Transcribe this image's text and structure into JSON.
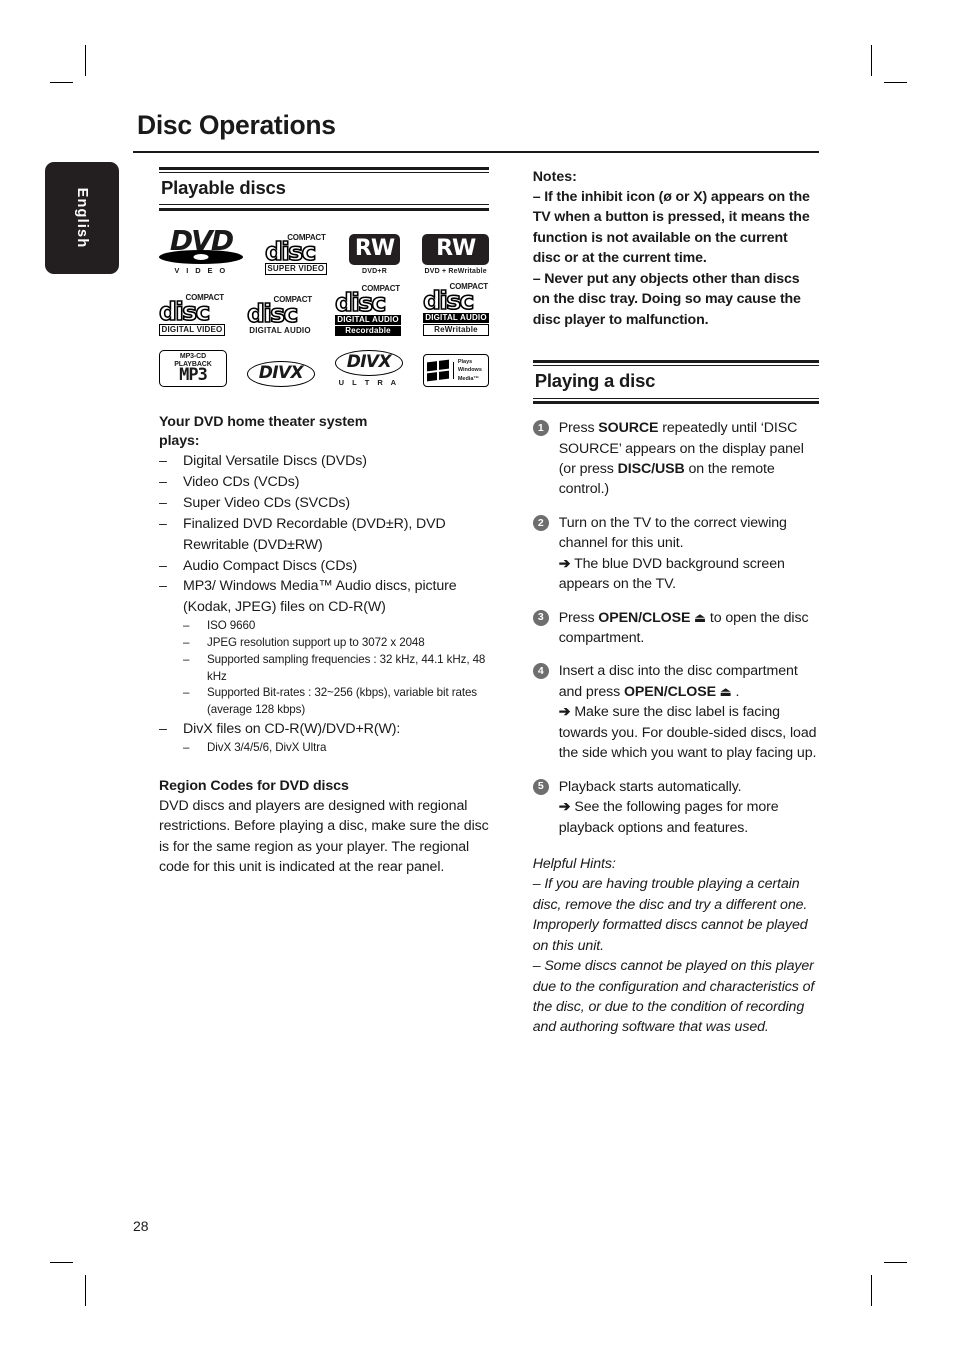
{
  "page": {
    "title": "Disc Operations",
    "number": "28",
    "language_tab": "English"
  },
  "left_column": {
    "section": {
      "title": "Playable discs"
    },
    "disc_logos": [
      [
        {
          "name": "dvd-video-logo",
          "mark": "DVD",
          "sub": "V I D E O"
        },
        {
          "name": "super-video-cd-logo",
          "top": "COMPACT",
          "word": "disc",
          "bar": "SUPER  VIDEO",
          "style": "boxed"
        },
        {
          "name": "dvd-plus-r-logo",
          "word": "RW",
          "sub": "DVD+R"
        },
        {
          "name": "dvd-plus-rewritable-logo",
          "word": "RW",
          "sub": "DVD + ReWritable"
        }
      ],
      [
        {
          "name": "compact-disc-digital-video-logo",
          "top": "COMPACT",
          "word": "disc",
          "bar": "DIGITAL VIDEO",
          "style": "boxed"
        },
        {
          "name": "compact-disc-digital-audio-logo",
          "top": "COMPACT",
          "word": "disc",
          "bar": "DIGITAL AUDIO",
          "style": "plain"
        },
        {
          "name": "compact-disc-recordable-logo",
          "top": "COMPACT",
          "word": "disc",
          "bar": "DIGITAL AUDIO",
          "bar2": "Recordable",
          "style": "inv"
        },
        {
          "name": "compact-disc-rewritable-logo",
          "top": "COMPACT",
          "word": "disc",
          "bar": "DIGITAL AUDIO",
          "bar2": "ReWritable",
          "style": "boxed2"
        }
      ],
      [
        {
          "name": "mp3-cd-playback-logo",
          "top": "MP3-CD PLAYBACK",
          "dots": "MP3"
        },
        {
          "name": "divx-logo",
          "word": "DIVX"
        },
        {
          "name": "divx-ultra-logo",
          "word": "DIVX",
          "sub": "U L T R A"
        },
        {
          "name": "windows-media-logo",
          "line1": "Plays",
          "line2": "Windows",
          "line3": "Media™"
        }
      ]
    ],
    "plays_heading_line1": "Your DVD home theater system",
    "plays_heading_line2": "plays:",
    "plays_items": [
      {
        "text": "Digital Versatile Discs (DVDs)"
      },
      {
        "text": "Video CDs (VCDs)"
      },
      {
        "text": "Super Video CDs (SVCDs)"
      },
      {
        "text": "Finalized DVD Recordable (DVD±R), DVD Rewritable (DVD±RW)"
      },
      {
        "text": "Audio Compact Discs (CDs)"
      },
      {
        "text": "MP3/ Windows Media™ Audio discs, picture (Kodak, JPEG) files on CD-R(W)",
        "sub_items": [
          "ISO 9660",
          "JPEG resolution support up to 3072 x 2048",
          "Supported sampling frequencies : 32 kHz, 44.1 kHz, 48 kHz",
          "Supported Bit-rates : 32~256 (kbps), variable bit rates (average 128 kbps)"
        ]
      },
      {
        "text": "DivX files on CD-R(W)/DVD+R(W):",
        "sub_items": [
          "DivX 3/4/5/6, DivX Ultra"
        ]
      }
    ],
    "region_heading": "Region Codes for DVD discs",
    "region_text": "DVD discs and players are designed with regional restrictions. Before playing a disc, make sure the disc is for the same region as your player.  The regional code for this unit is indicated at the rear panel."
  },
  "right_column": {
    "notes_title": "Notes:",
    "notes": [
      "– If the inhibit icon (ø or X) appears on the TV when a button is pressed, it means the function is not available on the current disc or at the current time.",
      "– Never put any objects other than discs on the disc tray.  Doing so may cause the disc player to malfunction."
    ],
    "section": {
      "title": "Playing a disc"
    },
    "steps": [
      {
        "num": "1",
        "parts": [
          {
            "t": "Press "
          },
          {
            "t": "SOURCE",
            "b": true
          },
          {
            "t": " repeatedly until ‘DISC SOURCE’ appears on the display panel (or press "
          },
          {
            "t": "DISC/USB",
            "b": true
          },
          {
            "t": " on the remote control.)"
          }
        ]
      },
      {
        "num": "2",
        "parts": [
          {
            "t": "Turn on the TV to the correct viewing channel for this unit."
          },
          {
            "t": "\n"
          },
          {
            "t": "➔",
            "arrow": true
          },
          {
            "t": " The blue DVD background screen appears on the TV."
          }
        ]
      },
      {
        "num": "3",
        "parts": [
          {
            "t": "Press "
          },
          {
            "t": "OPEN/CLOSE",
            "b": true
          },
          {
            "t": " ⏏",
            "eject": true
          },
          {
            "t": " to open the disc compartment."
          }
        ]
      },
      {
        "num": "4",
        "parts": [
          {
            "t": "Insert a disc into the disc compartment and press "
          },
          {
            "t": "OPEN/CLOSE",
            "b": true
          },
          {
            "t": " ⏏",
            "eject": true
          },
          {
            "t": " ."
          },
          {
            "t": "\n"
          },
          {
            "t": "➔",
            "arrow": true
          },
          {
            "t": " Make sure the disc label is facing towards you. For double-sided discs, load the side which you want to play facing up."
          }
        ]
      },
      {
        "num": "5",
        "parts": [
          {
            "t": "Playback starts automatically."
          },
          {
            "t": "\n"
          },
          {
            "t": "➔",
            "arrow": true
          },
          {
            "t": " See the following pages for more playback options and features."
          }
        ]
      }
    ],
    "hints_title": "Helpful Hints:",
    "hints": [
      "– If you are having trouble playing a certain disc, remove the disc and try a different one. Improperly formatted discs cannot be played on this unit.",
      "– Some discs cannot be played on this player due to the configuration and characteristics of the disc, or due to the condition of recording and authoring software that was used."
    ]
  },
  "icons": {
    "dash": "–",
    "arrow": "➔",
    "eject": "⏏"
  }
}
